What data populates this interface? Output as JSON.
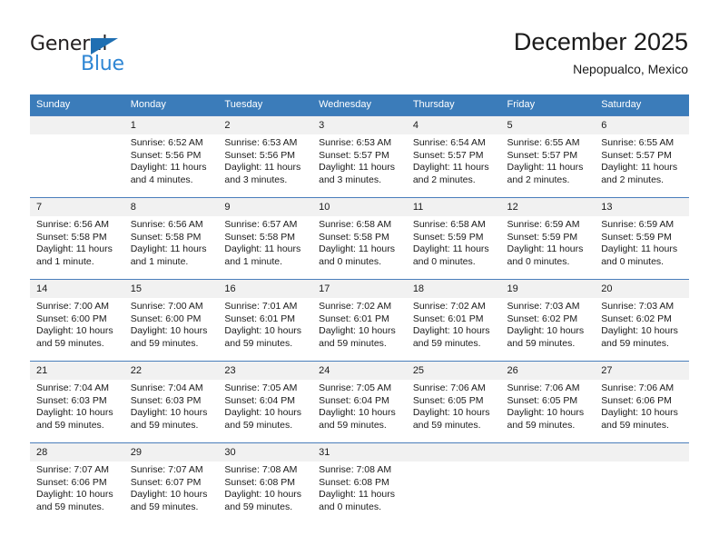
{
  "brand": {
    "name_top": "General",
    "name_bottom": "Blue",
    "triangle_color": "#1f6fb2",
    "blue_color": "#2e86d4"
  },
  "header": {
    "title": "December 2025",
    "subtitle": "Nepopualco, Mexico",
    "header_bg": "#3b7cba",
    "daynum_bg": "#f1f1f1",
    "row_border": "#4a7ebb"
  },
  "weekday_headers": [
    "Sunday",
    "Monday",
    "Tuesday",
    "Wednesday",
    "Thursday",
    "Friday",
    "Saturday"
  ],
  "weeks": [
    [
      {
        "day": "",
        "sunrise": "",
        "sunset": "",
        "daylight_line1": "",
        "daylight_line2": "",
        "empty": true
      },
      {
        "day": "1",
        "sunrise": "Sunrise: 6:52 AM",
        "sunset": "Sunset: 5:56 PM",
        "daylight_line1": "Daylight: 11 hours",
        "daylight_line2": "and 4 minutes."
      },
      {
        "day": "2",
        "sunrise": "Sunrise: 6:53 AM",
        "sunset": "Sunset: 5:56 PM",
        "daylight_line1": "Daylight: 11 hours",
        "daylight_line2": "and 3 minutes."
      },
      {
        "day": "3",
        "sunrise": "Sunrise: 6:53 AM",
        "sunset": "Sunset: 5:57 PM",
        "daylight_line1": "Daylight: 11 hours",
        "daylight_line2": "and 3 minutes."
      },
      {
        "day": "4",
        "sunrise": "Sunrise: 6:54 AM",
        "sunset": "Sunset: 5:57 PM",
        "daylight_line1": "Daylight: 11 hours",
        "daylight_line2": "and 2 minutes."
      },
      {
        "day": "5",
        "sunrise": "Sunrise: 6:55 AM",
        "sunset": "Sunset: 5:57 PM",
        "daylight_line1": "Daylight: 11 hours",
        "daylight_line2": "and 2 minutes."
      },
      {
        "day": "6",
        "sunrise": "Sunrise: 6:55 AM",
        "sunset": "Sunset: 5:57 PM",
        "daylight_line1": "Daylight: 11 hours",
        "daylight_line2": "and 2 minutes."
      }
    ],
    [
      {
        "day": "7",
        "sunrise": "Sunrise: 6:56 AM",
        "sunset": "Sunset: 5:58 PM",
        "daylight_line1": "Daylight: 11 hours",
        "daylight_line2": "and 1 minute."
      },
      {
        "day": "8",
        "sunrise": "Sunrise: 6:56 AM",
        "sunset": "Sunset: 5:58 PM",
        "daylight_line1": "Daylight: 11 hours",
        "daylight_line2": "and 1 minute."
      },
      {
        "day": "9",
        "sunrise": "Sunrise: 6:57 AM",
        "sunset": "Sunset: 5:58 PM",
        "daylight_line1": "Daylight: 11 hours",
        "daylight_line2": "and 1 minute."
      },
      {
        "day": "10",
        "sunrise": "Sunrise: 6:58 AM",
        "sunset": "Sunset: 5:58 PM",
        "daylight_line1": "Daylight: 11 hours",
        "daylight_line2": "and 0 minutes."
      },
      {
        "day": "11",
        "sunrise": "Sunrise: 6:58 AM",
        "sunset": "Sunset: 5:59 PM",
        "daylight_line1": "Daylight: 11 hours",
        "daylight_line2": "and 0 minutes."
      },
      {
        "day": "12",
        "sunrise": "Sunrise: 6:59 AM",
        "sunset": "Sunset: 5:59 PM",
        "daylight_line1": "Daylight: 11 hours",
        "daylight_line2": "and 0 minutes."
      },
      {
        "day": "13",
        "sunrise": "Sunrise: 6:59 AM",
        "sunset": "Sunset: 5:59 PM",
        "daylight_line1": "Daylight: 11 hours",
        "daylight_line2": "and 0 minutes."
      }
    ],
    [
      {
        "day": "14",
        "sunrise": "Sunrise: 7:00 AM",
        "sunset": "Sunset: 6:00 PM",
        "daylight_line1": "Daylight: 10 hours",
        "daylight_line2": "and 59 minutes."
      },
      {
        "day": "15",
        "sunrise": "Sunrise: 7:00 AM",
        "sunset": "Sunset: 6:00 PM",
        "daylight_line1": "Daylight: 10 hours",
        "daylight_line2": "and 59 minutes."
      },
      {
        "day": "16",
        "sunrise": "Sunrise: 7:01 AM",
        "sunset": "Sunset: 6:01 PM",
        "daylight_line1": "Daylight: 10 hours",
        "daylight_line2": "and 59 minutes."
      },
      {
        "day": "17",
        "sunrise": "Sunrise: 7:02 AM",
        "sunset": "Sunset: 6:01 PM",
        "daylight_line1": "Daylight: 10 hours",
        "daylight_line2": "and 59 minutes."
      },
      {
        "day": "18",
        "sunrise": "Sunrise: 7:02 AM",
        "sunset": "Sunset: 6:01 PM",
        "daylight_line1": "Daylight: 10 hours",
        "daylight_line2": "and 59 minutes."
      },
      {
        "day": "19",
        "sunrise": "Sunrise: 7:03 AM",
        "sunset": "Sunset: 6:02 PM",
        "daylight_line1": "Daylight: 10 hours",
        "daylight_line2": "and 59 minutes."
      },
      {
        "day": "20",
        "sunrise": "Sunrise: 7:03 AM",
        "sunset": "Sunset: 6:02 PM",
        "daylight_line1": "Daylight: 10 hours",
        "daylight_line2": "and 59 minutes."
      }
    ],
    [
      {
        "day": "21",
        "sunrise": "Sunrise: 7:04 AM",
        "sunset": "Sunset: 6:03 PM",
        "daylight_line1": "Daylight: 10 hours",
        "daylight_line2": "and 59 minutes."
      },
      {
        "day": "22",
        "sunrise": "Sunrise: 7:04 AM",
        "sunset": "Sunset: 6:03 PM",
        "daylight_line1": "Daylight: 10 hours",
        "daylight_line2": "and 59 minutes."
      },
      {
        "day": "23",
        "sunrise": "Sunrise: 7:05 AM",
        "sunset": "Sunset: 6:04 PM",
        "daylight_line1": "Daylight: 10 hours",
        "daylight_line2": "and 59 minutes."
      },
      {
        "day": "24",
        "sunrise": "Sunrise: 7:05 AM",
        "sunset": "Sunset: 6:04 PM",
        "daylight_line1": "Daylight: 10 hours",
        "daylight_line2": "and 59 minutes."
      },
      {
        "day": "25",
        "sunrise": "Sunrise: 7:06 AM",
        "sunset": "Sunset: 6:05 PM",
        "daylight_line1": "Daylight: 10 hours",
        "daylight_line2": "and 59 minutes."
      },
      {
        "day": "26",
        "sunrise": "Sunrise: 7:06 AM",
        "sunset": "Sunset: 6:05 PM",
        "daylight_line1": "Daylight: 10 hours",
        "daylight_line2": "and 59 minutes."
      },
      {
        "day": "27",
        "sunrise": "Sunrise: 7:06 AM",
        "sunset": "Sunset: 6:06 PM",
        "daylight_line1": "Daylight: 10 hours",
        "daylight_line2": "and 59 minutes."
      }
    ],
    [
      {
        "day": "28",
        "sunrise": "Sunrise: 7:07 AM",
        "sunset": "Sunset: 6:06 PM",
        "daylight_line1": "Daylight: 10 hours",
        "daylight_line2": "and 59 minutes."
      },
      {
        "day": "29",
        "sunrise": "Sunrise: 7:07 AM",
        "sunset": "Sunset: 6:07 PM",
        "daylight_line1": "Daylight: 10 hours",
        "daylight_line2": "and 59 minutes."
      },
      {
        "day": "30",
        "sunrise": "Sunrise: 7:08 AM",
        "sunset": "Sunset: 6:08 PM",
        "daylight_line1": "Daylight: 10 hours",
        "daylight_line2": "and 59 minutes."
      },
      {
        "day": "31",
        "sunrise": "Sunrise: 7:08 AM",
        "sunset": "Sunset: 6:08 PM",
        "daylight_line1": "Daylight: 11 hours",
        "daylight_line2": "and 0 minutes."
      },
      {
        "day": "",
        "sunrise": "",
        "sunset": "",
        "daylight_line1": "",
        "daylight_line2": "",
        "empty": true
      },
      {
        "day": "",
        "sunrise": "",
        "sunset": "",
        "daylight_line1": "",
        "daylight_line2": "",
        "empty": true
      },
      {
        "day": "",
        "sunrise": "",
        "sunset": "",
        "daylight_line1": "",
        "daylight_line2": "",
        "empty": true
      }
    ]
  ]
}
